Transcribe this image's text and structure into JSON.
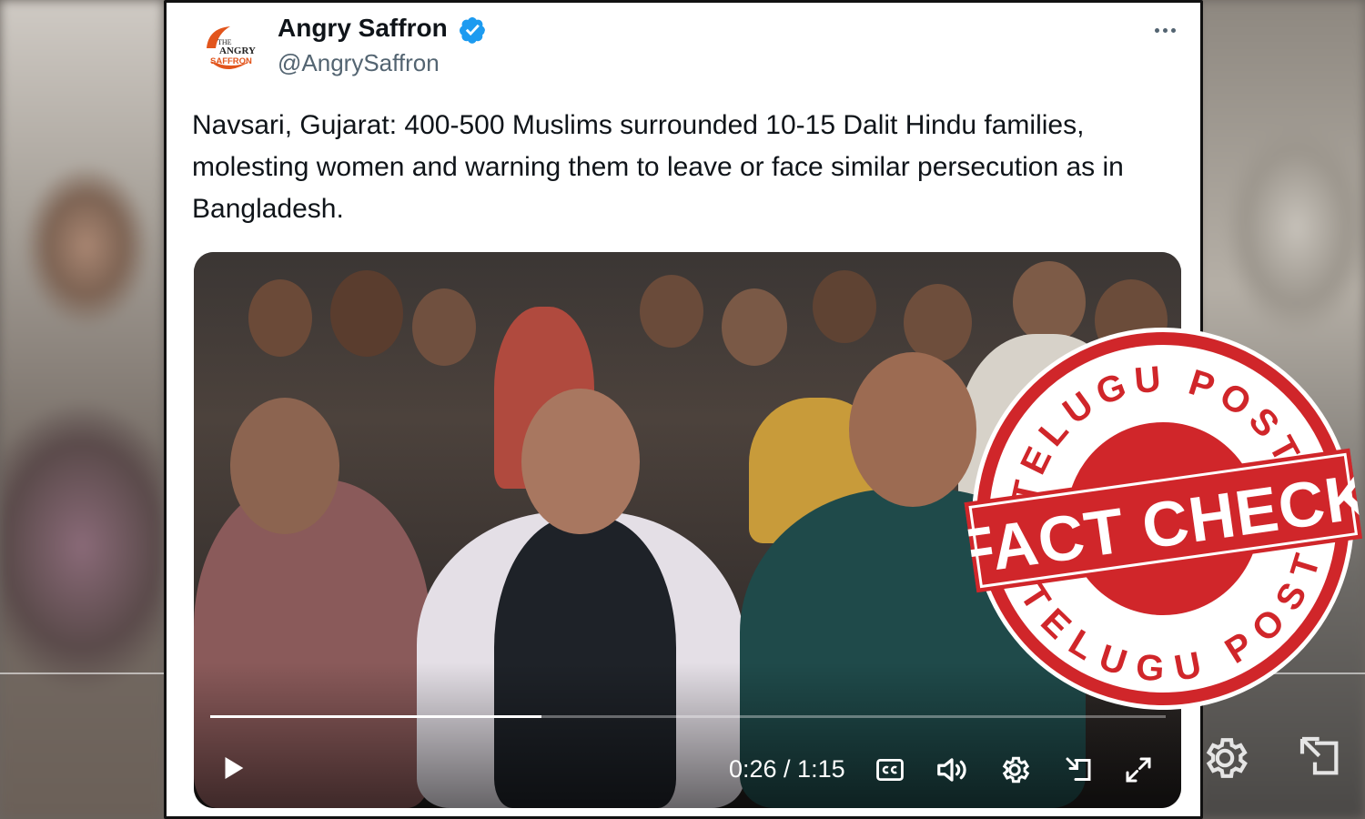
{
  "tweet": {
    "author_name": "Angry Saffron",
    "author_handle": "@AngrySaffron",
    "logo_text_lines": [
      "THE",
      "ANGRY",
      "SAFFRON"
    ],
    "text": "Navsari, Gujarat: 400-500 Muslims surrounded 10-15 Dalit Hindu families, molesting women and warning them to leave or face similar persecution as in Bangladesh.",
    "verified": true
  },
  "video": {
    "current_time": "0:26",
    "duration": "1:15",
    "time_display": "0:26 / 1:15",
    "progress_fraction": 0.347,
    "controls": [
      "play-icon",
      "captions-icon",
      "volume-icon",
      "settings-icon",
      "pip-icon",
      "fullscreen-icon"
    ]
  },
  "stamp": {
    "top_text": "TELUGU POST",
    "center_text": "FACT CHECK",
    "bottom_text": "TELUGU POST",
    "color": "#d0262a"
  },
  "colors": {
    "verified_blue": "#1d9bf0",
    "text_primary": "#0f1419",
    "text_secondary": "#536471",
    "stamp_red": "#d0262a"
  }
}
